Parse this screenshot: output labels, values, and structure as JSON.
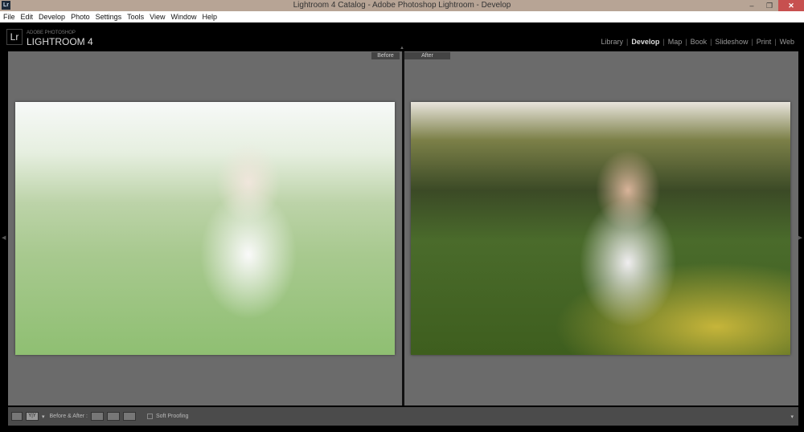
{
  "window": {
    "title": "Lightroom 4 Catalog - Adobe Photoshop Lightroom - Develop",
    "app_icon": "Lr",
    "minimize": "–",
    "restore": "❐",
    "close": "✕"
  },
  "menu": [
    "File",
    "Edit",
    "Develop",
    "Photo",
    "Settings",
    "Tools",
    "View",
    "Window",
    "Help"
  ],
  "logo": {
    "mark": "Lr",
    "sub": "ADOBE PHOTOSHOP",
    "name": "LIGHTROOM 4"
  },
  "modules": [
    "Library",
    "Develop",
    "Map",
    "Book",
    "Slideshow",
    "Print",
    "Web"
  ],
  "active_module": "Develop",
  "view": {
    "before_label": "Before",
    "after_label": "After"
  },
  "toolbar": {
    "view_mode": "Y|Y",
    "before_after_label": "Before & After :",
    "soft_proofing_label": "Soft Proofing",
    "soft_proofing_checked": false
  }
}
